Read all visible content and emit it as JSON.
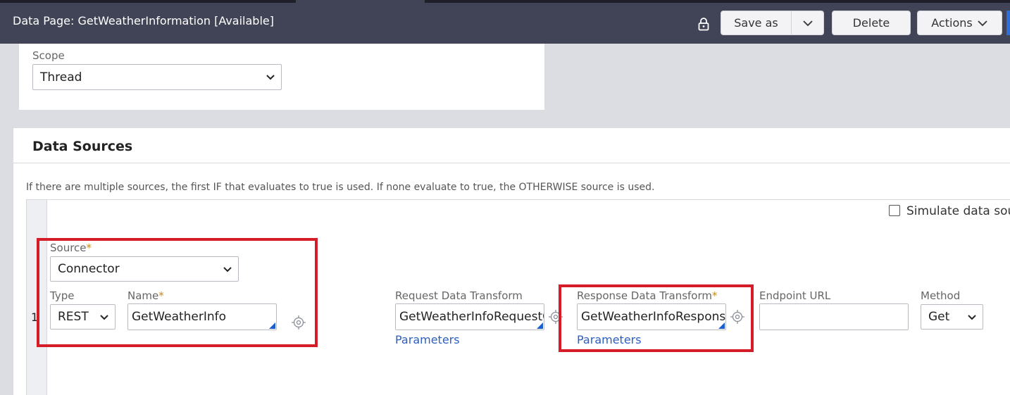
{
  "header": {
    "title": "Data Page: GetWeatherInformation [Available]",
    "save_as": "Save as",
    "delete": "Delete",
    "actions": "Actions"
  },
  "scope": {
    "label": "Scope",
    "value": "Thread"
  },
  "data_sources": {
    "title": "Data Sources",
    "note": "If there are multiple sources, the first IF that evaluates to true is used. If none evaluate to true, the OTHERWISE source is used.",
    "simulate_label": "Simulate data sou",
    "row": {
      "number": "1",
      "source_label": "Source",
      "source_value": "Connector",
      "type_label": "Type",
      "type_value": "REST",
      "name_label": "Name",
      "name_value": "GetWeatherInfo",
      "request_label": "Request Data Transform",
      "request_value": "GetWeatherInfoRequestC",
      "request_params": "Parameters",
      "response_label": "Response Data Transform",
      "response_value": "GetWeatherInfoResponse",
      "response_params": "Parameters",
      "endpoint_label": "Endpoint URL",
      "endpoint_value": "",
      "method_label": "Method",
      "method_value": "Get"
    },
    "required_mark": "*"
  },
  "colors": {
    "header_bg": "#414456",
    "highlight": "#d51d2a",
    "link": "#2b5fc4",
    "required": "#c88a1d"
  }
}
